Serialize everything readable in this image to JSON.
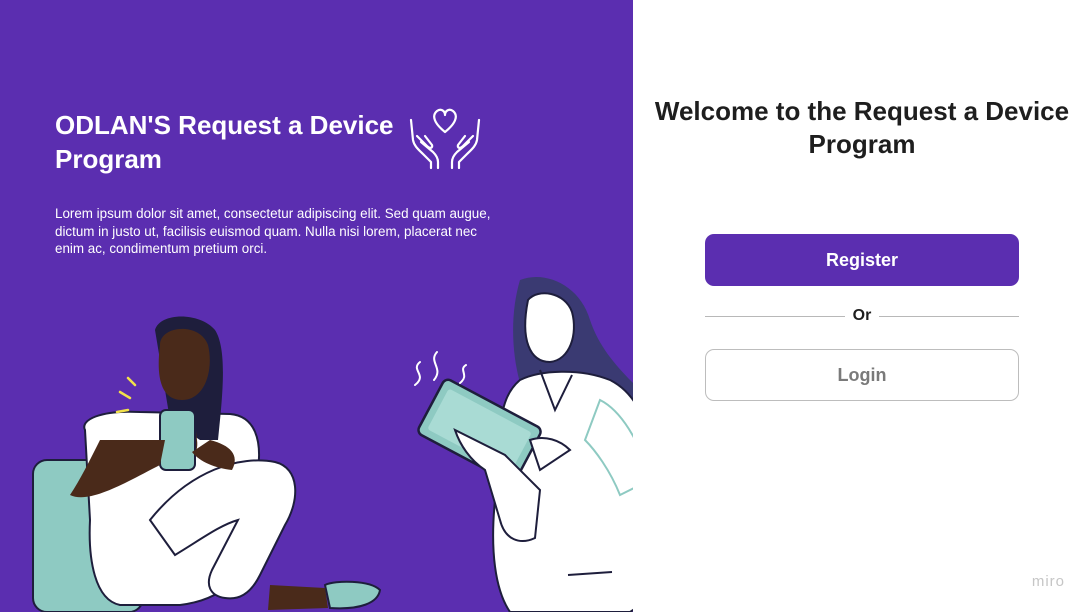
{
  "left": {
    "title": "ODLAN'S Request a Device Program",
    "description": "Lorem ipsum dolor sit amet, consectetur adipiscing elit. Sed quam augue, dictum in justo ut, facilisis euismod quam. Nulla nisi lorem, placerat nec enim ac, condimentum pretium orci.",
    "icon": "hands-holding-heart-icon",
    "background_color": "#5b2eb0"
  },
  "right": {
    "welcome_title": "Welcome to the Request a Device Program",
    "register_label": "Register",
    "divider_label": "Or",
    "login_label": "Login",
    "accent_color": "#5b2eb0"
  },
  "watermark": "miro"
}
